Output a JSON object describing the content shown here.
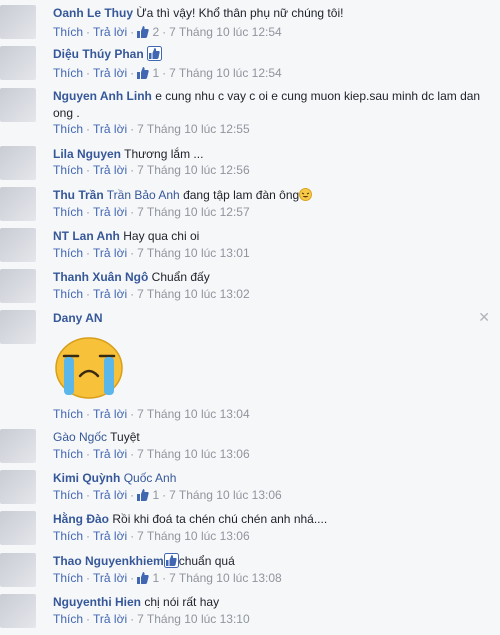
{
  "comments": [
    {
      "name": "Oanh Le Thuy",
      "text": "Ừa thì vậy! Khổ thân phụ nữ chúng tôi!",
      "like": "Thích",
      "reply": "Trả lời",
      "likes": "2",
      "time": "7 Tháng 10 lúc 12:54"
    },
    {
      "name": "Diệu Thúy Phan",
      "text": "",
      "like": "Thích",
      "reply": "Trả lời",
      "likes": "1",
      "time": "7 Tháng 10 lúc 12:54"
    },
    {
      "name": "Nguyen Anh Linh",
      "text": "e cung nhu c vay c oi e cung muon kiep.sau minh dc lam dan ong .",
      "like": "Thích",
      "reply": "Trả lời",
      "time": "7 Tháng 10 lúc 12:55"
    },
    {
      "name": "Lila Nguyen",
      "text": "Thương lắm ...",
      "like": "Thích",
      "reply": "Trả lời",
      "time": "7 Tháng 10 lúc 12:56"
    },
    {
      "name": "Thu Trần",
      "tag": "Trần Bảo Anh",
      "text": "đang tập lam đàn ông",
      "like": "Thích",
      "reply": "Trả lời",
      "time": "7 Tháng 10 lúc 12:57"
    },
    {
      "name": "NT Lan Anh",
      "text": "Hay qua chi oi",
      "like": "Thích",
      "reply": "Trả lời",
      "time": "7 Tháng 10 lúc 13:01"
    },
    {
      "name": "Thanh Xuân Ngô",
      "text": "Chuẩn đấy",
      "like": "Thích",
      "reply": "Trả lời",
      "time": "7 Tháng 10 lúc 13:02"
    },
    {
      "name": "Dany AN",
      "text": "",
      "like": "Thích",
      "reply": "Trả lời",
      "time": "7 Tháng 10 lúc 13:04"
    },
    {
      "name": "Gào Ngốc",
      "text": "Tuyệt",
      "like": "Thích",
      "reply": "Trả lời",
      "time": "7 Tháng 10 lúc 13:06"
    },
    {
      "name": "Kimi Quỳnh",
      "tag": "Quốc Anh",
      "text": "",
      "like": "Thích",
      "reply": "Trả lời",
      "likes": "1",
      "time": "7 Tháng 10 lúc 13:06"
    },
    {
      "name": "Hằng Đào",
      "text": "Rồi khi đoá ta chén chú chén anh nhá....",
      "like": "Thích",
      "reply": "Trả lời",
      "time": "7 Tháng 10 lúc 13:06"
    },
    {
      "name": "Thao Nguyenkhiem",
      "text": "chuẩn quá",
      "like": "Thích",
      "reply": "Trả lời",
      "likes": "1",
      "time": "7 Tháng 10 lúc 13:08"
    },
    {
      "name": "Nguyenthi Hien",
      "text": "chị nói rất hay",
      "like": "Thích",
      "reply": "Trả lời",
      "time": "7 Tháng 10 lúc 13:10"
    }
  ],
  "colors": {
    "link": "#365899",
    "action": "#4267b2",
    "meta": "#90949c",
    "background": "#f6f7f9"
  }
}
